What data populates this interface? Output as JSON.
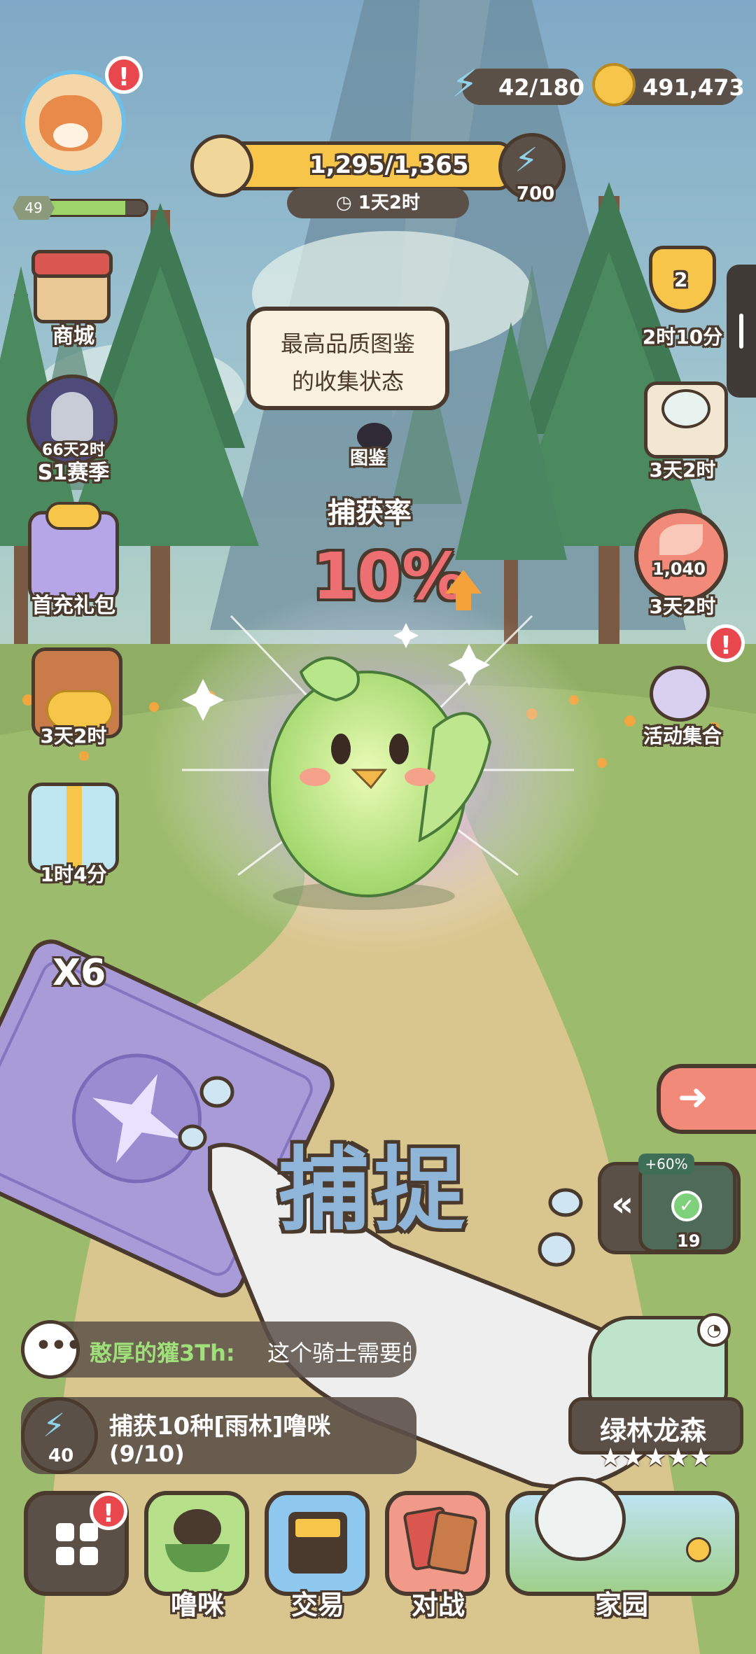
{
  "hud": {
    "level": "49",
    "energy": "42/180",
    "gold": "491,473",
    "exp_progress": "1,295/1,365",
    "exp_timer": "1天2时",
    "energy_reward": "700"
  },
  "left_menu": {
    "shop": "商城",
    "season_timer": "66天2时",
    "season": "S1赛季",
    "first_charge": "首充礼包",
    "chest_timer": "3天2时",
    "gift_timer": "1时4分"
  },
  "right_menu": {
    "trophy_count": "2",
    "trophy_timer": "2时10分",
    "map_timer": "3天2时",
    "leaf_count": "1,040",
    "leaf_timer": "3天2时",
    "events": "活动集合"
  },
  "encounter": {
    "tooltip_line1": "最高品质图鉴",
    "tooltip_line2": "的收集状态",
    "codex_label": "图鉴",
    "capture_rate_label": "捕获率",
    "capture_rate": "10%",
    "card_multiplier": "X6",
    "capture_button": "捕捉",
    "bait_bonus": "+60%",
    "bait_count": "19"
  },
  "chat": {
    "sender": "憨厚的獾3Th:",
    "message": "这个骑士需要的"
  },
  "quest": {
    "reward": "40",
    "title": "捕获10种[雨林]噜咪",
    "progress": "(9/10)"
  },
  "location": {
    "name": "绿林龙森"
  },
  "nav": {
    "lumi": "噜咪",
    "trade": "交易",
    "battle": "对战",
    "home": "家园"
  },
  "colors": {
    "accent_gold": "#f6c54a",
    "badge_red": "#e8474e",
    "capture_rate_red": "#ee6f72",
    "card_purple": "#a99ad8",
    "dark_brown": "#4a3a2e"
  }
}
